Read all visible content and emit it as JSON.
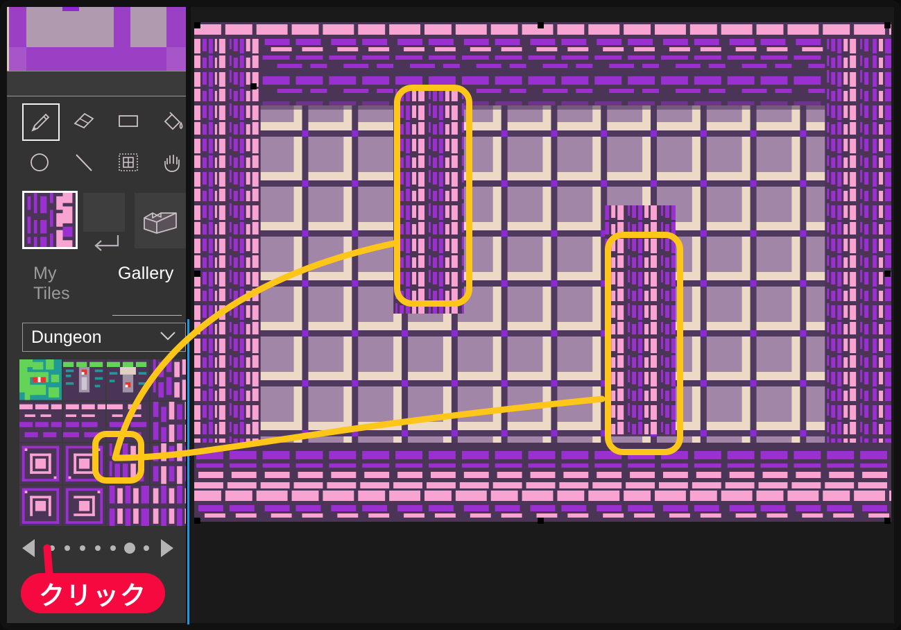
{
  "app": {
    "title": "Pixel Tile Editor",
    "accent_yellow": "#FFC61A",
    "accent_red": "#F5093F",
    "sidebar_bg": "#333333",
    "canvas_bg": "#1a1a1a"
  },
  "toolbar": {
    "rows": [
      [
        {
          "name": "pencil-tool",
          "icon": "pencil-icon",
          "label": "Pencil",
          "active": true
        },
        {
          "name": "eraser-tool",
          "icon": "eraser-icon",
          "label": "Eraser",
          "active": false
        },
        {
          "name": "rect-tool",
          "icon": "rectangle-icon",
          "label": "Rectangle",
          "active": false
        },
        {
          "name": "fill-tool",
          "icon": "paint-bucket-icon",
          "label": "Fill",
          "active": false
        }
      ],
      [
        {
          "name": "ellipse-tool",
          "icon": "circle-icon",
          "label": "Ellipse",
          "active": false
        },
        {
          "name": "line-tool",
          "icon": "line-icon",
          "label": "Line",
          "active": false
        },
        {
          "name": "select-tool",
          "icon": "grid-select-icon",
          "label": "Select",
          "active": false
        },
        {
          "name": "pan-tool",
          "icon": "hand-icon",
          "label": "Pan",
          "active": false
        }
      ]
    ]
  },
  "slots": {
    "selected_tile_label": "Selected tile",
    "empty_slot_label": "Empty slot",
    "enter_icon": "enter-return-icon",
    "cube_icon": "isometric-block-icon",
    "cube_label": "3D block view"
  },
  "tabs": [
    {
      "name": "tab-my-tiles",
      "label_line1": "My",
      "label_line2": "Tiles",
      "active": false
    },
    {
      "name": "tab-gallery",
      "label_line1": "Gallery",
      "label_line2": "",
      "active": true
    }
  ],
  "dropdown": {
    "label": "Dungeon",
    "chevron_icon": "chevron-down-icon",
    "options": [
      "Dungeon"
    ]
  },
  "gallery": {
    "tiles": [
      {
        "name": "tile-foliage-mushroom",
        "kind": "foliage"
      },
      {
        "name": "tile-statue-left",
        "kind": "statue"
      },
      {
        "name": "tile-statue-right",
        "kind": "statue2"
      },
      {
        "name": "tile-wall-vertical-1",
        "kind": "vwall"
      },
      {
        "name": "tile-brick-wall-1",
        "kind": "brick"
      },
      {
        "name": "tile-brick-wall-2",
        "kind": "brick"
      },
      {
        "name": "tile-brick-wall-3",
        "kind": "brick"
      },
      {
        "name": "tile-wall-vertical-2",
        "kind": "vwall"
      },
      {
        "name": "tile-pattern-maze-1",
        "kind": "maze"
      },
      {
        "name": "tile-pattern-maze-2",
        "kind": "maze"
      },
      {
        "name": "tile-wall-vertical-selected",
        "kind": "vwall",
        "highlighted": true
      },
      {
        "name": "tile-wall-vertical-3",
        "kind": "vwall"
      },
      {
        "name": "tile-pattern-maze-3",
        "kind": "maze"
      },
      {
        "name": "tile-pattern-maze-4",
        "kind": "maze"
      },
      {
        "name": "tile-wall-vertical-4",
        "kind": "vwall"
      },
      {
        "name": "tile-wall-vertical-5",
        "kind": "vwall"
      }
    ]
  },
  "pager": {
    "prev_label": "Previous page",
    "next_label": "Next page",
    "dots": 7,
    "active_index": 5
  },
  "callout": {
    "badge_text": "クリック",
    "highlight_color": "#FFC61A",
    "targets": [
      {
        "name": "highlight-canvas-pillar-upper"
      },
      {
        "name": "highlight-canvas-pillar-lower"
      },
      {
        "name": "highlight-gallery-tile"
      }
    ]
  },
  "canvas": {
    "title": "Dungeon room artwork",
    "selection_handles": 8
  },
  "palette": {
    "wall_dark": "#4a3557",
    "wall_purple": "#9b30d0",
    "wall_pink": "#f9a3d2",
    "floor_mauve": "#a286a8",
    "floor_cream": "#ecd9c6",
    "floor_shadow": "#4f3a5e",
    "accent_violet": "#8e2ad4",
    "foliage_green": "#63d457",
    "foliage_teal": "#1f9a96",
    "mushroom_red": "#e8342b"
  }
}
